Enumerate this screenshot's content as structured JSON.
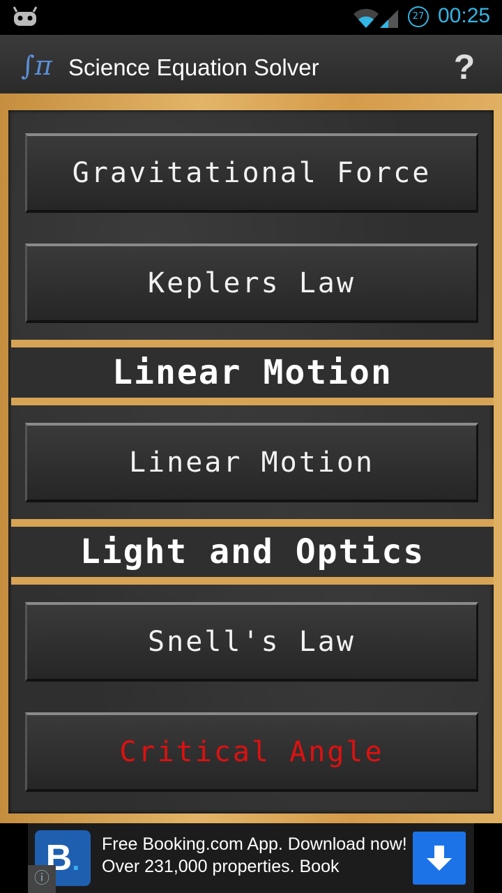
{
  "status_bar": {
    "time": "00:25",
    "alarm_badge": "27",
    "left_icon": "android-robot-icon",
    "wifi_icon": "wifi-icon",
    "signal_icon": "cell-signal-icon"
  },
  "action_bar": {
    "app_icon_glyph": "∫π",
    "title": "Science Equation Solver",
    "help_label": "?"
  },
  "items": {
    "gravitational_force": "Gravitational Force",
    "keplers_law": "Keplers Law",
    "section_linear_motion": "Linear Motion",
    "linear_motion": "Linear Motion",
    "section_light_optics": "Light and Optics",
    "snells_law": "Snell's Law",
    "critical_angle": "Critical Angle"
  },
  "colors": {
    "accent_blue": "#33b5e5",
    "highlight_red": "#e01010",
    "wood": "#d7a455",
    "chalkboard": "#2f2f2f"
  },
  "ad": {
    "logo_letter": "B",
    "logo_dot": ".",
    "text": "Free Booking.com App. Download now! Over 231,000 properties. Book",
    "info_icon": "info-icon",
    "download_icon": "download-arrow-icon"
  }
}
